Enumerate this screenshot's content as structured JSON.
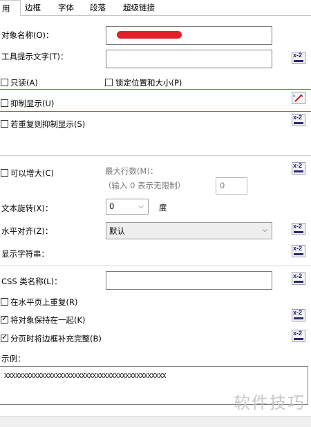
{
  "tabs": [
    "用",
    "边框",
    "字体",
    "段落",
    "超级链接"
  ],
  "labels": {
    "object_name": "对象名称(O)：",
    "tooltip_text": "工具提示文字(T)：",
    "readonly": "只读(A)",
    "lock_position": "锁定位置和大小(P)",
    "suppress": "抑制显示(U)",
    "suppress_if_dup": "若重复则抑制显示(S)",
    "can_grow": "可以增大(C)",
    "max_lines": "最大行数(M)：",
    "max_lines_hint": "（输入 0 表示无限制）",
    "text_rotation": "文本旋转(X)：",
    "degrees": "度",
    "horiz_align": "水平对齐(Z)：",
    "display_string": "显示字符串：",
    "css_class": "CSS 类名称(L)：",
    "repeat_horiz": "在水平页上重复(R)",
    "keep_together": "将对象保持在一起(K)",
    "close_border": "分页时将边框补充完整(B)",
    "sample": "示例："
  },
  "values": {
    "max_lines": "0",
    "rotation": "0",
    "horiz_align": "默认",
    "sample_text": "XXXXXXXXXXXXXXXXXXXXXXXXXXXXXXXXXXXXXXXXXXXX"
  },
  "formula_button_label": "x-2",
  "watermark": "软件技巧",
  "colors": {
    "red_rule": "#c0504d",
    "redact": "#e0202a"
  }
}
